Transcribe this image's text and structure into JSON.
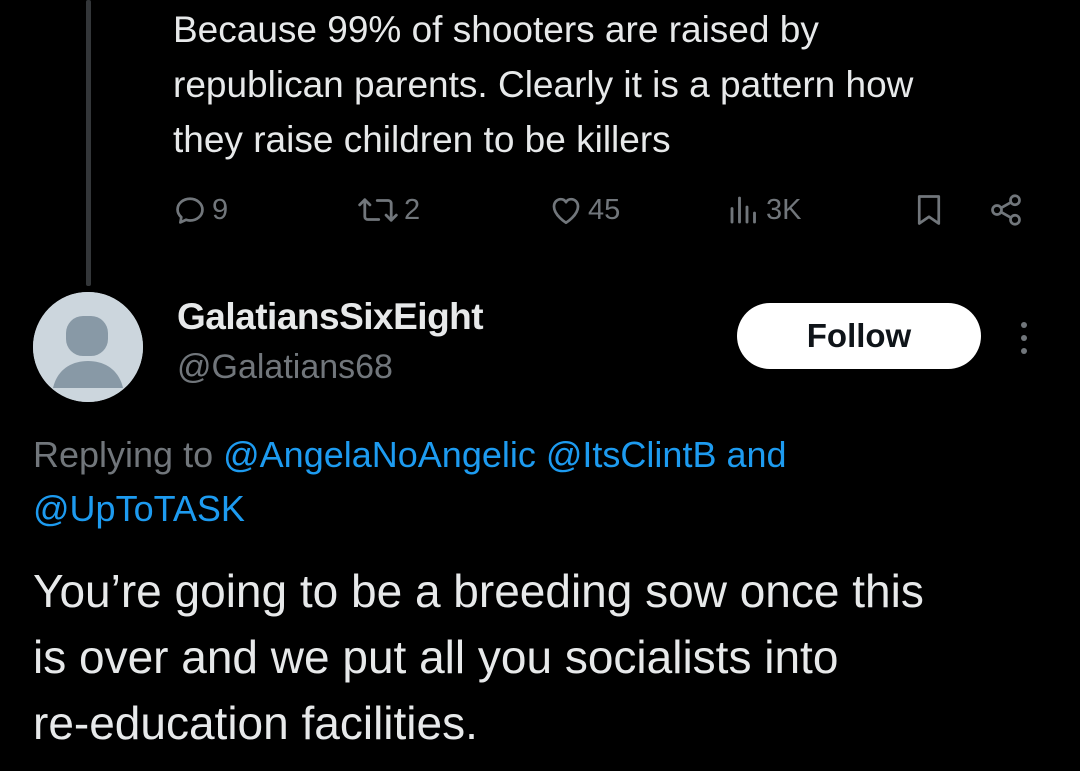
{
  "parent_tweet": {
    "text": "Because 99% of shooters are raised by\nrepublican parents. Clearly it is a pattern how\nthey raise children to be killers",
    "actions": {
      "reply_count": "9",
      "retweet_count": "2",
      "like_count": "45",
      "view_count": "3K"
    }
  },
  "reply_tweet": {
    "display_name": "GalatiansSixEight",
    "handle": "@Galatians68",
    "follow_label": "Follow",
    "replying_prefix": "Replying to",
    "mention_1": "@AngelaNoAngelic",
    "mention_2": "@ItsClintB",
    "mention_and": "and",
    "mention_3": "@UpToTASK",
    "text": "You’re going to be a breeding sow once this\nis over and we put all you socialists into\nre-education facilities."
  },
  "colors": {
    "background": "#000000",
    "text_primary": "#e7e9ea",
    "text_secondary": "#71767b",
    "link": "#1d9bf0",
    "follow_bg": "#ffffff"
  },
  "icons": [
    "reply-icon",
    "retweet-icon",
    "like-icon",
    "views-icon",
    "bookmark-icon",
    "share-icon",
    "more-icon",
    "default-avatar-icon"
  ]
}
